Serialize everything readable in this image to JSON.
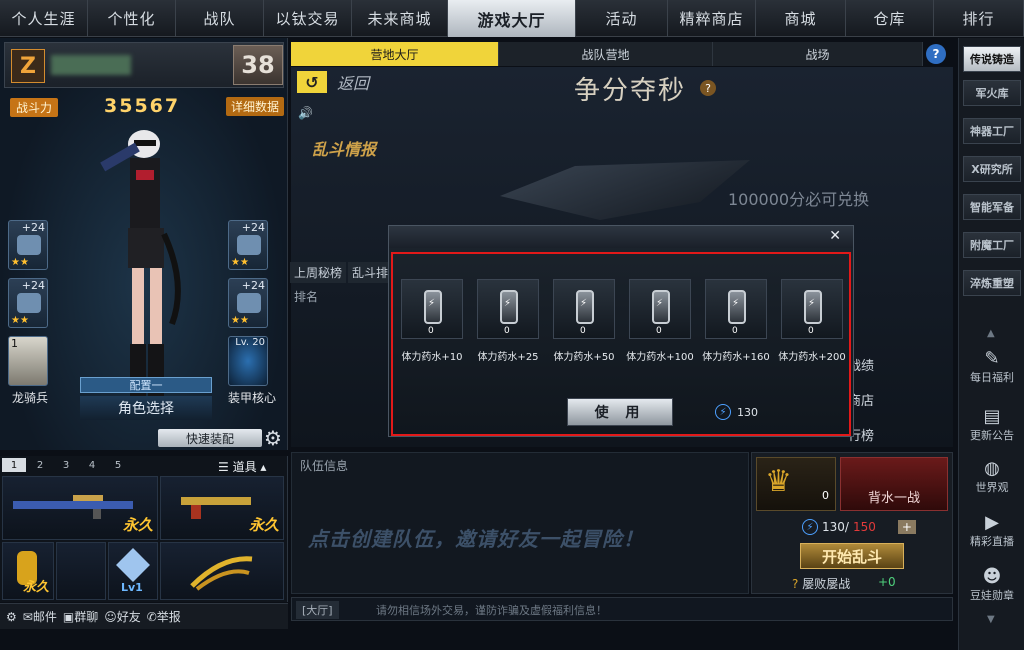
{
  "topnav": {
    "tabs": [
      "个人生涯",
      "个性化",
      "战队",
      "以钛交易",
      "未来商城",
      "游戏大厅",
      "活动",
      "精粹商店",
      "商城",
      "仓库",
      "排行"
    ],
    "active": "游戏大厅"
  },
  "player": {
    "level": "38",
    "power_label": "战斗力",
    "power_value": "35567",
    "detail_label": "详细数据"
  },
  "character": {
    "left_slots": [
      {
        "plus": "+24",
        "stars": "★★"
      },
      {
        "plus": "+24",
        "stars": "★★"
      }
    ],
    "right_slots": [
      {
        "plus": "+24",
        "stars": "★★"
      },
      {
        "plus": "+24",
        "stars": "★★"
      }
    ],
    "pet_count": "1",
    "pet_name": "龙骑兵",
    "core_level": "Lv. 20",
    "core_name": "装甲核心",
    "config_label": "配置一",
    "role_select": "角色选择",
    "quick_equip": "快速装配"
  },
  "weapons": {
    "tabs": [
      "1",
      "2",
      "3",
      "4",
      "5"
    ],
    "props_label": "道具",
    "items": [
      "永久",
      "永久",
      "永久",
      "Lv1",
      ""
    ]
  },
  "bottombar": {
    "mail": "邮件",
    "group": "群聊",
    "friends": "好友",
    "report": "举报"
  },
  "subtabs": [
    "营地大厅",
    "战队营地",
    "战场"
  ],
  "main": {
    "back": "返回",
    "title": "争分夺秒",
    "exchange": "100000分必可兑换",
    "news": "乱斗情报",
    "left_tabs": [
      "上周秘榜",
      "乱斗排"
    ],
    "rank_col": "排名",
    "right_links": [
      "战绩",
      "商店",
      "行榜"
    ]
  },
  "modal": {
    "items": [
      {
        "label": "体力药水+10",
        "count": "0"
      },
      {
        "label": "体力药水+25",
        "count": "0"
      },
      {
        "label": "体力药水+50",
        "count": "0"
      },
      {
        "label": "体力药水+100",
        "count": "0"
      },
      {
        "label": "体力药水+160",
        "count": "0"
      },
      {
        "label": "体力药水+200",
        "count": "0"
      }
    ],
    "use": "使 用",
    "energy": "130"
  },
  "team": {
    "header": "队伍信息",
    "invite": "点击创建队伍，邀请好友一起冒险！",
    "lion_count": "0",
    "back_water": "背水一战",
    "energy": "130/",
    "energy_max": "150",
    "start": "开始乱斗",
    "shame": "屡败屡战",
    "shame_val": "+0"
  },
  "chat": {
    "channel": "[大厅]",
    "text": "请勿相信场外交易，谨防诈骗及虚假福利信息！"
  },
  "sidebar": {
    "buttons": [
      "传说铸造",
      "军火库",
      "神器工厂",
      "X研究所",
      "智能军备",
      "附魔工厂",
      "淬炼重塑"
    ],
    "icons": [
      "每日福利",
      "更新公告",
      "世界观",
      "精彩直播",
      "豆娃勋章"
    ]
  }
}
